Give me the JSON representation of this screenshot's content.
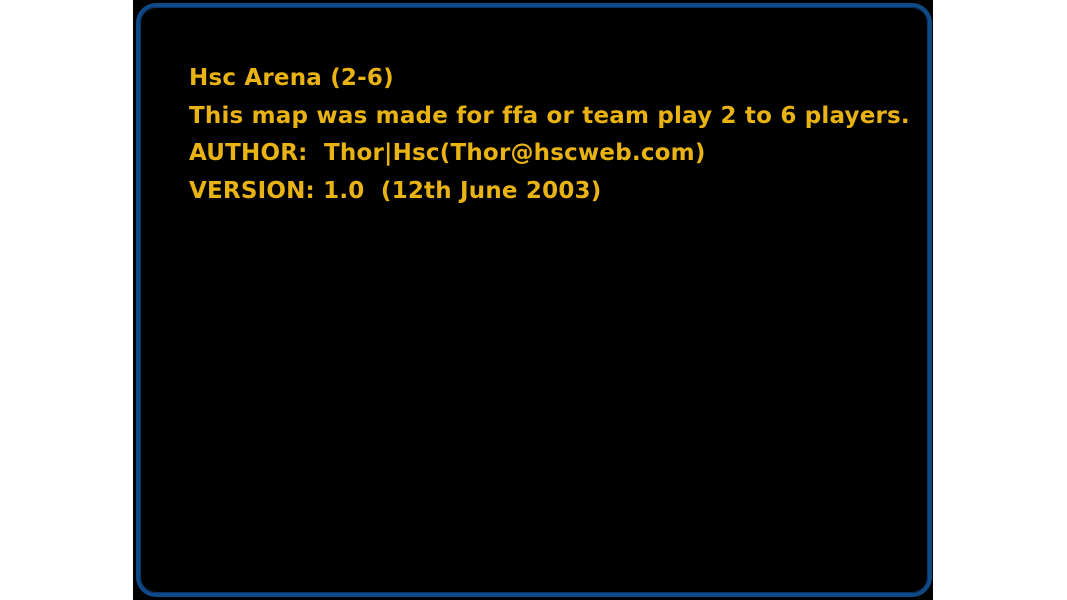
{
  "map_info": {
    "title": "Hsc Arena (2-6)",
    "description": "This map was made for ffa or team play 2 to 6 players.",
    "author": "AUTHOR:  Thor|Hsc(Thor@hscweb.com)",
    "version": "VERSION: 1.0  (12th June 2003)"
  },
  "colors": {
    "text": "#e8b313",
    "border": "#0f4a86",
    "background": "#000000"
  }
}
